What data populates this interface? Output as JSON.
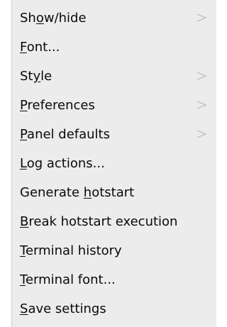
{
  "menu": {
    "items": [
      {
        "label": "Show/hide",
        "mnemonic": "o",
        "submenu": true
      },
      {
        "label": "Font...",
        "mnemonic": "F",
        "submenu": false
      },
      {
        "label": "Style",
        "mnemonic": "y",
        "submenu": true
      },
      {
        "label": "Preferences",
        "mnemonic": "P",
        "submenu": true
      },
      {
        "label": "Panel defaults",
        "mnemonic": "P",
        "submenu": true
      },
      {
        "label": "Log actions...",
        "mnemonic": "L",
        "submenu": false
      },
      {
        "label": "Generate hotstart",
        "mnemonic": "h",
        "submenu": false
      },
      {
        "label": "Break hotstart execution",
        "mnemonic": "B",
        "submenu": false
      },
      {
        "label": "Terminal history",
        "mnemonic": "T",
        "submenu": false
      },
      {
        "label": "Terminal font...",
        "mnemonic": "T",
        "submenu": false
      },
      {
        "label": "Save settings",
        "mnemonic": "S",
        "submenu": false
      }
    ],
    "submenu_arrow_icon": "submenu-arrow-icon",
    "colors": {
      "background": "#ececec",
      "text": "#0a0a0a",
      "arrow": "#b8b8b8"
    }
  }
}
